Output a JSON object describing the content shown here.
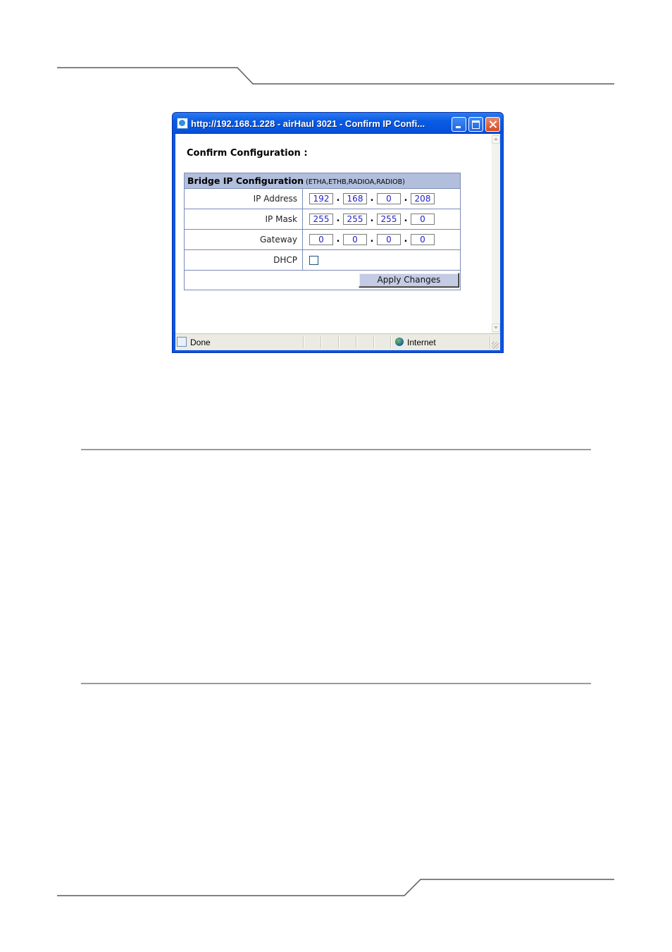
{
  "window": {
    "title": "http://192.168.1.228 - airHaul 3021 - Confirm IP Confi...",
    "icon": "ie-page-icon"
  },
  "content": {
    "heading": "Confirm Configuration :",
    "section": {
      "title": "Bridge IP Configuration",
      "subtitle": "(ETHA,ETHB,RADIOA,RADIOB)"
    },
    "ip_address": {
      "label": "IP Address",
      "octets": [
        "192",
        "168",
        "0",
        "208"
      ]
    },
    "ip_mask": {
      "label": "IP Mask",
      "octets": [
        "255",
        "255",
        "255",
        "0"
      ]
    },
    "gateway": {
      "label": "Gateway",
      "octets": [
        "0",
        "0",
        "0",
        "0"
      ]
    },
    "dhcp": {
      "label": "DHCP",
      "checked": false
    },
    "apply_label": "Apply Changes"
  },
  "status_bar": {
    "left_text": "Done",
    "zone_text": "Internet"
  },
  "colors": {
    "title_bar": "#0a55e3",
    "section_header": "#b2bfdc",
    "field_text": "#2222cc",
    "button_face": "#c4cbe4"
  }
}
